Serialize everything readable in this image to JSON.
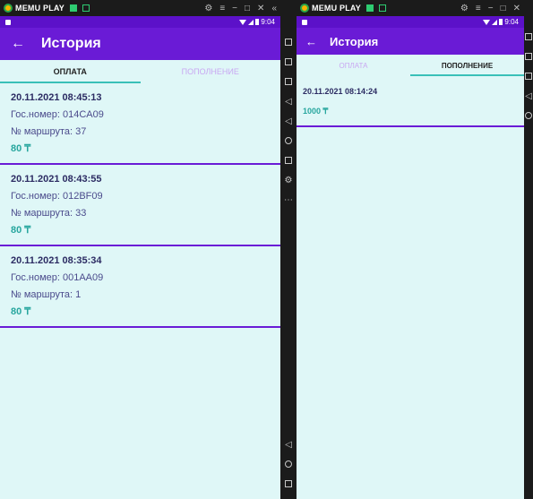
{
  "emulator": {
    "title": "MEMU PLAY",
    "window_controls": [
      "⚙",
      "≡",
      "−",
      "□",
      "✕"
    ],
    "collapse_glyph": "«"
  },
  "left": {
    "status_time": "9:04",
    "app_title": "История",
    "tabs": [
      {
        "label": "ОПЛАТА"
      },
      {
        "label": "ПОПОЛНЕНИЕ"
      }
    ],
    "payments": [
      {
        "datetime": "20.11.2021 08:45:13",
        "plate": "Гос.номер: 014CA09",
        "route": "№ маршрута: 37",
        "amount": "80 ₸"
      },
      {
        "datetime": "20.11.2021 08:43:55",
        "plate": "Гос.номер: 012BF09",
        "route": "№ маршрута: 33",
        "amount": "80 ₸"
      },
      {
        "datetime": "20.11.2021 08:35:34",
        "plate": "Гос.номер: 001AA09",
        "route": "№ маршрута: 1",
        "amount": "80 ₸"
      }
    ]
  },
  "right": {
    "status_time": "9:04",
    "app_title": "История",
    "tabs": [
      {
        "label": "ОПЛАТА"
      },
      {
        "label": "ПОПОЛНЕНИЕ"
      }
    ],
    "topups": [
      {
        "datetime": "20.11.2021 08:14:24",
        "amount": "1000 ₸"
      }
    ]
  },
  "colors": {
    "primary": "#6a1bd6",
    "status": "#5c11c9",
    "background": "#dff7f7",
    "accent": "#27a69e",
    "card_text": "#2c2c63"
  }
}
